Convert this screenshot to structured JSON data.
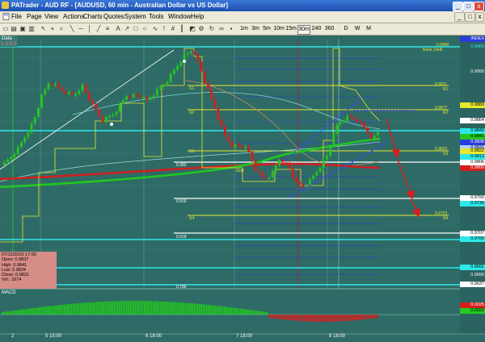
{
  "window": {
    "title": "PATrader - AUD RF - [AUDUSD, 60 min - Australian Dollar vs US Dollar]",
    "min_label": "_",
    "max_label": "□",
    "close_label": "x"
  },
  "menu": {
    "items": [
      "File",
      "Page",
      "View",
      "Actions",
      "Charts",
      "Quotes",
      "System",
      "Tools",
      "Window",
      "Help"
    ]
  },
  "toolbar": {
    "timeframes": [
      "1m",
      "3m",
      "5m",
      "10m",
      "15m",
      "30m",
      "240",
      "360",
      "D",
      "W",
      "M"
    ]
  },
  "panels": {
    "data_label": "Data",
    "macd_label": "MACD",
    "lock_label": "L:0:0.0"
  },
  "ohlc": {
    "date": "07/12/2010 17:00",
    "open": "Open: 0.9837",
    "high": "High: 0.9841",
    "low": "Low: 0.9824",
    "close": "Close: 0.9831",
    "vol": "Vol.: 1674"
  },
  "price_axis": {
    "top": "INDEX",
    "labels": [
      "0.9969",
      "0.9950",
      "0.9883",
      "0.9864",
      "0.9840",
      "0.9841",
      "0.9838",
      "0.9831",
      "0.9822",
      "0.9812",
      "0.9806",
      "0.9800",
      "0.9750",
      "0.9736",
      "0.9707",
      "0.9700",
      "0.9661",
      "0.9650",
      "0.9637"
    ]
  },
  "macd_axis": [
    "0.0025",
    "0.0022"
  ],
  "time_axis": [
    "2",
    "5 15:00",
    "6 18:00",
    "7 18:00",
    "8 18:00"
  ],
  "chart_labels": {
    "r2": "0.9969",
    "base": "Base (Sell)",
    "r1_val": "0.9911",
    "r1": "R1",
    "s1_top": "S1",
    "s2_top": "S2",
    "r2b": "R2",
    "r2b_val": "0.9877",
    "s3": "S3",
    "s3_val": "0.9822",
    "s3_right": "S3",
    "fib382": "0.382",
    "fib500": "0.500",
    "fib618": "0.618",
    "fib786": "0.786",
    "s4": "S4",
    "s4_val": "0.9723",
    "s4_right": "S4",
    "gnd": "Gnd"
  },
  "colors": {
    "bg": "#2e6b66",
    "bull": "#22c81e",
    "bear": "#d41e1e",
    "cyan": "#2ee8e8",
    "yellow": "#e8e830",
    "white": "#ffffff",
    "blue": "#2a3adc",
    "red": "#c41818"
  }
}
